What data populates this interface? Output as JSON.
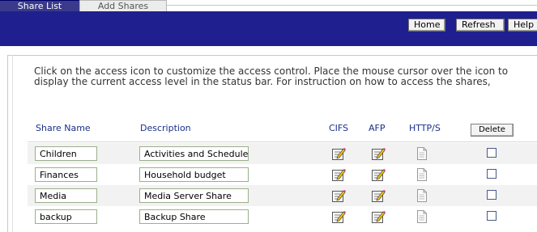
{
  "tabs": [
    {
      "label": "Share List",
      "active": true
    },
    {
      "label": "Add Shares",
      "active": false
    }
  ],
  "toolbar": {
    "home_label": "Home",
    "refresh_label": "Refresh",
    "help_label": "Help",
    "background": "#1f1f8f"
  },
  "instructions": "Click on the access icon to customize the access control. Place the mouse cursor over the icon to display the current access level in the status bar. For instruction on how to access the shares,",
  "columns": {
    "name": "Share Name",
    "description": "Description",
    "cifs": "CIFS",
    "afp": "AFP",
    "http": "HTTP/S",
    "delete_label": "Delete"
  },
  "shares": [
    {
      "name": "Children",
      "description": "Activities and Schedule",
      "cifs_icon": "edit-access-icon",
      "afp_icon": "edit-access-icon",
      "http_icon": "document-icon",
      "checked": false
    },
    {
      "name": "Finances",
      "description": "Household budget",
      "cifs_icon": "edit-access-icon",
      "afp_icon": "edit-access-icon",
      "http_icon": "document-icon",
      "checked": false
    },
    {
      "name": "Media",
      "description": "Media Server Share",
      "cifs_icon": "edit-access-icon",
      "afp_icon": "edit-access-icon",
      "http_icon": "document-icon",
      "checked": false
    },
    {
      "name": "backup",
      "description": "Backup Share",
      "cifs_icon": "edit-access-icon",
      "afp_icon": "edit-access-icon",
      "http_icon": "document-icon",
      "checked": false
    }
  ]
}
